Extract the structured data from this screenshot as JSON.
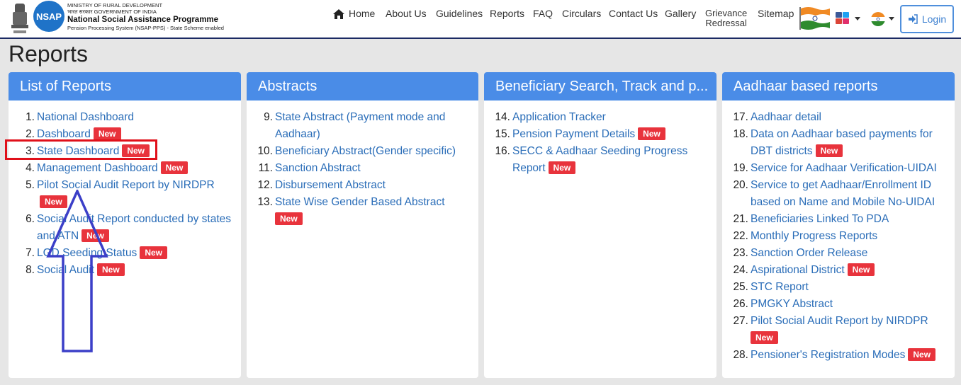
{
  "header": {
    "ministry_en": "MINISTRY OF RURAL DEVELOPMENT",
    "ministry_hi": "भारत सरकार  GOVERNMENT OF INDIA",
    "programme": "National Social Assistance Programme",
    "system": "Pension Processing System (NSAP-PPS) - State Scheme enabled",
    "logo_text": "NSAP",
    "login_label": "Login"
  },
  "nav": [
    {
      "label": "Home"
    },
    {
      "label": "About Us"
    },
    {
      "label": "Guidelines"
    },
    {
      "label": "Reports"
    },
    {
      "label": "FAQ"
    },
    {
      "label": "Circulars"
    },
    {
      "label": "Contact Us"
    },
    {
      "label": "Gallery"
    },
    {
      "label_line1": "Grievance",
      "label_line2": "Redressal"
    },
    {
      "label": "Sitemap"
    }
  ],
  "page_title": "Reports",
  "badge_label": "New",
  "cards": [
    {
      "title": "List of Reports",
      "items": [
        {
          "num": "1.",
          "text": "National Dashboard",
          "new": false
        },
        {
          "num": "2.",
          "text": "Dashboard",
          "new": true
        },
        {
          "num": "3.",
          "text": "State Dashboard",
          "new": true
        },
        {
          "num": "4.",
          "text": "Management Dashboard",
          "new": true
        },
        {
          "num": "5.",
          "text": "Pilot Social Audit Report by NIRDPR",
          "new": true
        },
        {
          "num": "6.",
          "text": "Social Audit Report conducted by states and ATN",
          "new": true
        },
        {
          "num": "7.",
          "text": "LGD Seeding Status",
          "new": true
        },
        {
          "num": "8.",
          "text": "Social Audit",
          "new": true
        }
      ]
    },
    {
      "title": "Abstracts",
      "items": [
        {
          "num": "9.",
          "text": "State Abstract (Payment mode and Aadhaar)",
          "new": false
        },
        {
          "num": "10.",
          "text": "Beneficiary Abstract(Gender specific)",
          "new": false
        },
        {
          "num": "11.",
          "text": "Sanction Abstract",
          "new": false
        },
        {
          "num": "12.",
          "text": "Disbursement Abstract",
          "new": false
        },
        {
          "num": "13.",
          "text": "State Wise Gender Based Abstract",
          "new": true
        }
      ]
    },
    {
      "title": "Beneficiary Search, Track and p...",
      "items": [
        {
          "num": "14.",
          "text": "Application Tracker",
          "new": false
        },
        {
          "num": "15.",
          "text": "Pension Payment Details",
          "new": true
        },
        {
          "num": "16.",
          "text": "SECC & Aadhaar Seeding Progress Report",
          "new": true
        }
      ]
    },
    {
      "title": "Aadhaar based reports",
      "items": [
        {
          "num": "17.",
          "text": "Aadhaar detail",
          "new": false
        },
        {
          "num": "18.",
          "text": "Data on Aadhaar based payments for DBT districts",
          "new": true
        },
        {
          "num": "19.",
          "text": "Service for Aadhaar Verification-UIDAI",
          "new": false
        },
        {
          "num": "20.",
          "text": "Service to get Aadhaar/Enrollment ID based on Name and Mobile No-UIDAI",
          "new": false
        },
        {
          "num": "21.",
          "text": "Beneficiaries Linked To PDA",
          "new": false
        },
        {
          "num": "22.",
          "text": "Monthly Progress Reports",
          "new": false
        },
        {
          "num": "23.",
          "text": "Sanction Order Release",
          "new": false
        },
        {
          "num": "24.",
          "text": "Aspirational District",
          "new": true
        },
        {
          "num": "25.",
          "text": "STC Report",
          "new": false
        },
        {
          "num": "26.",
          "text": "PMGKY Abstract",
          "new": false
        },
        {
          "num": "27.",
          "text": "Pilot Social Audit Report by NIRDPR",
          "new": true
        },
        {
          "num": "28.",
          "text": "Pensioner's Registration Modes",
          "new": true
        }
      ]
    }
  ]
}
